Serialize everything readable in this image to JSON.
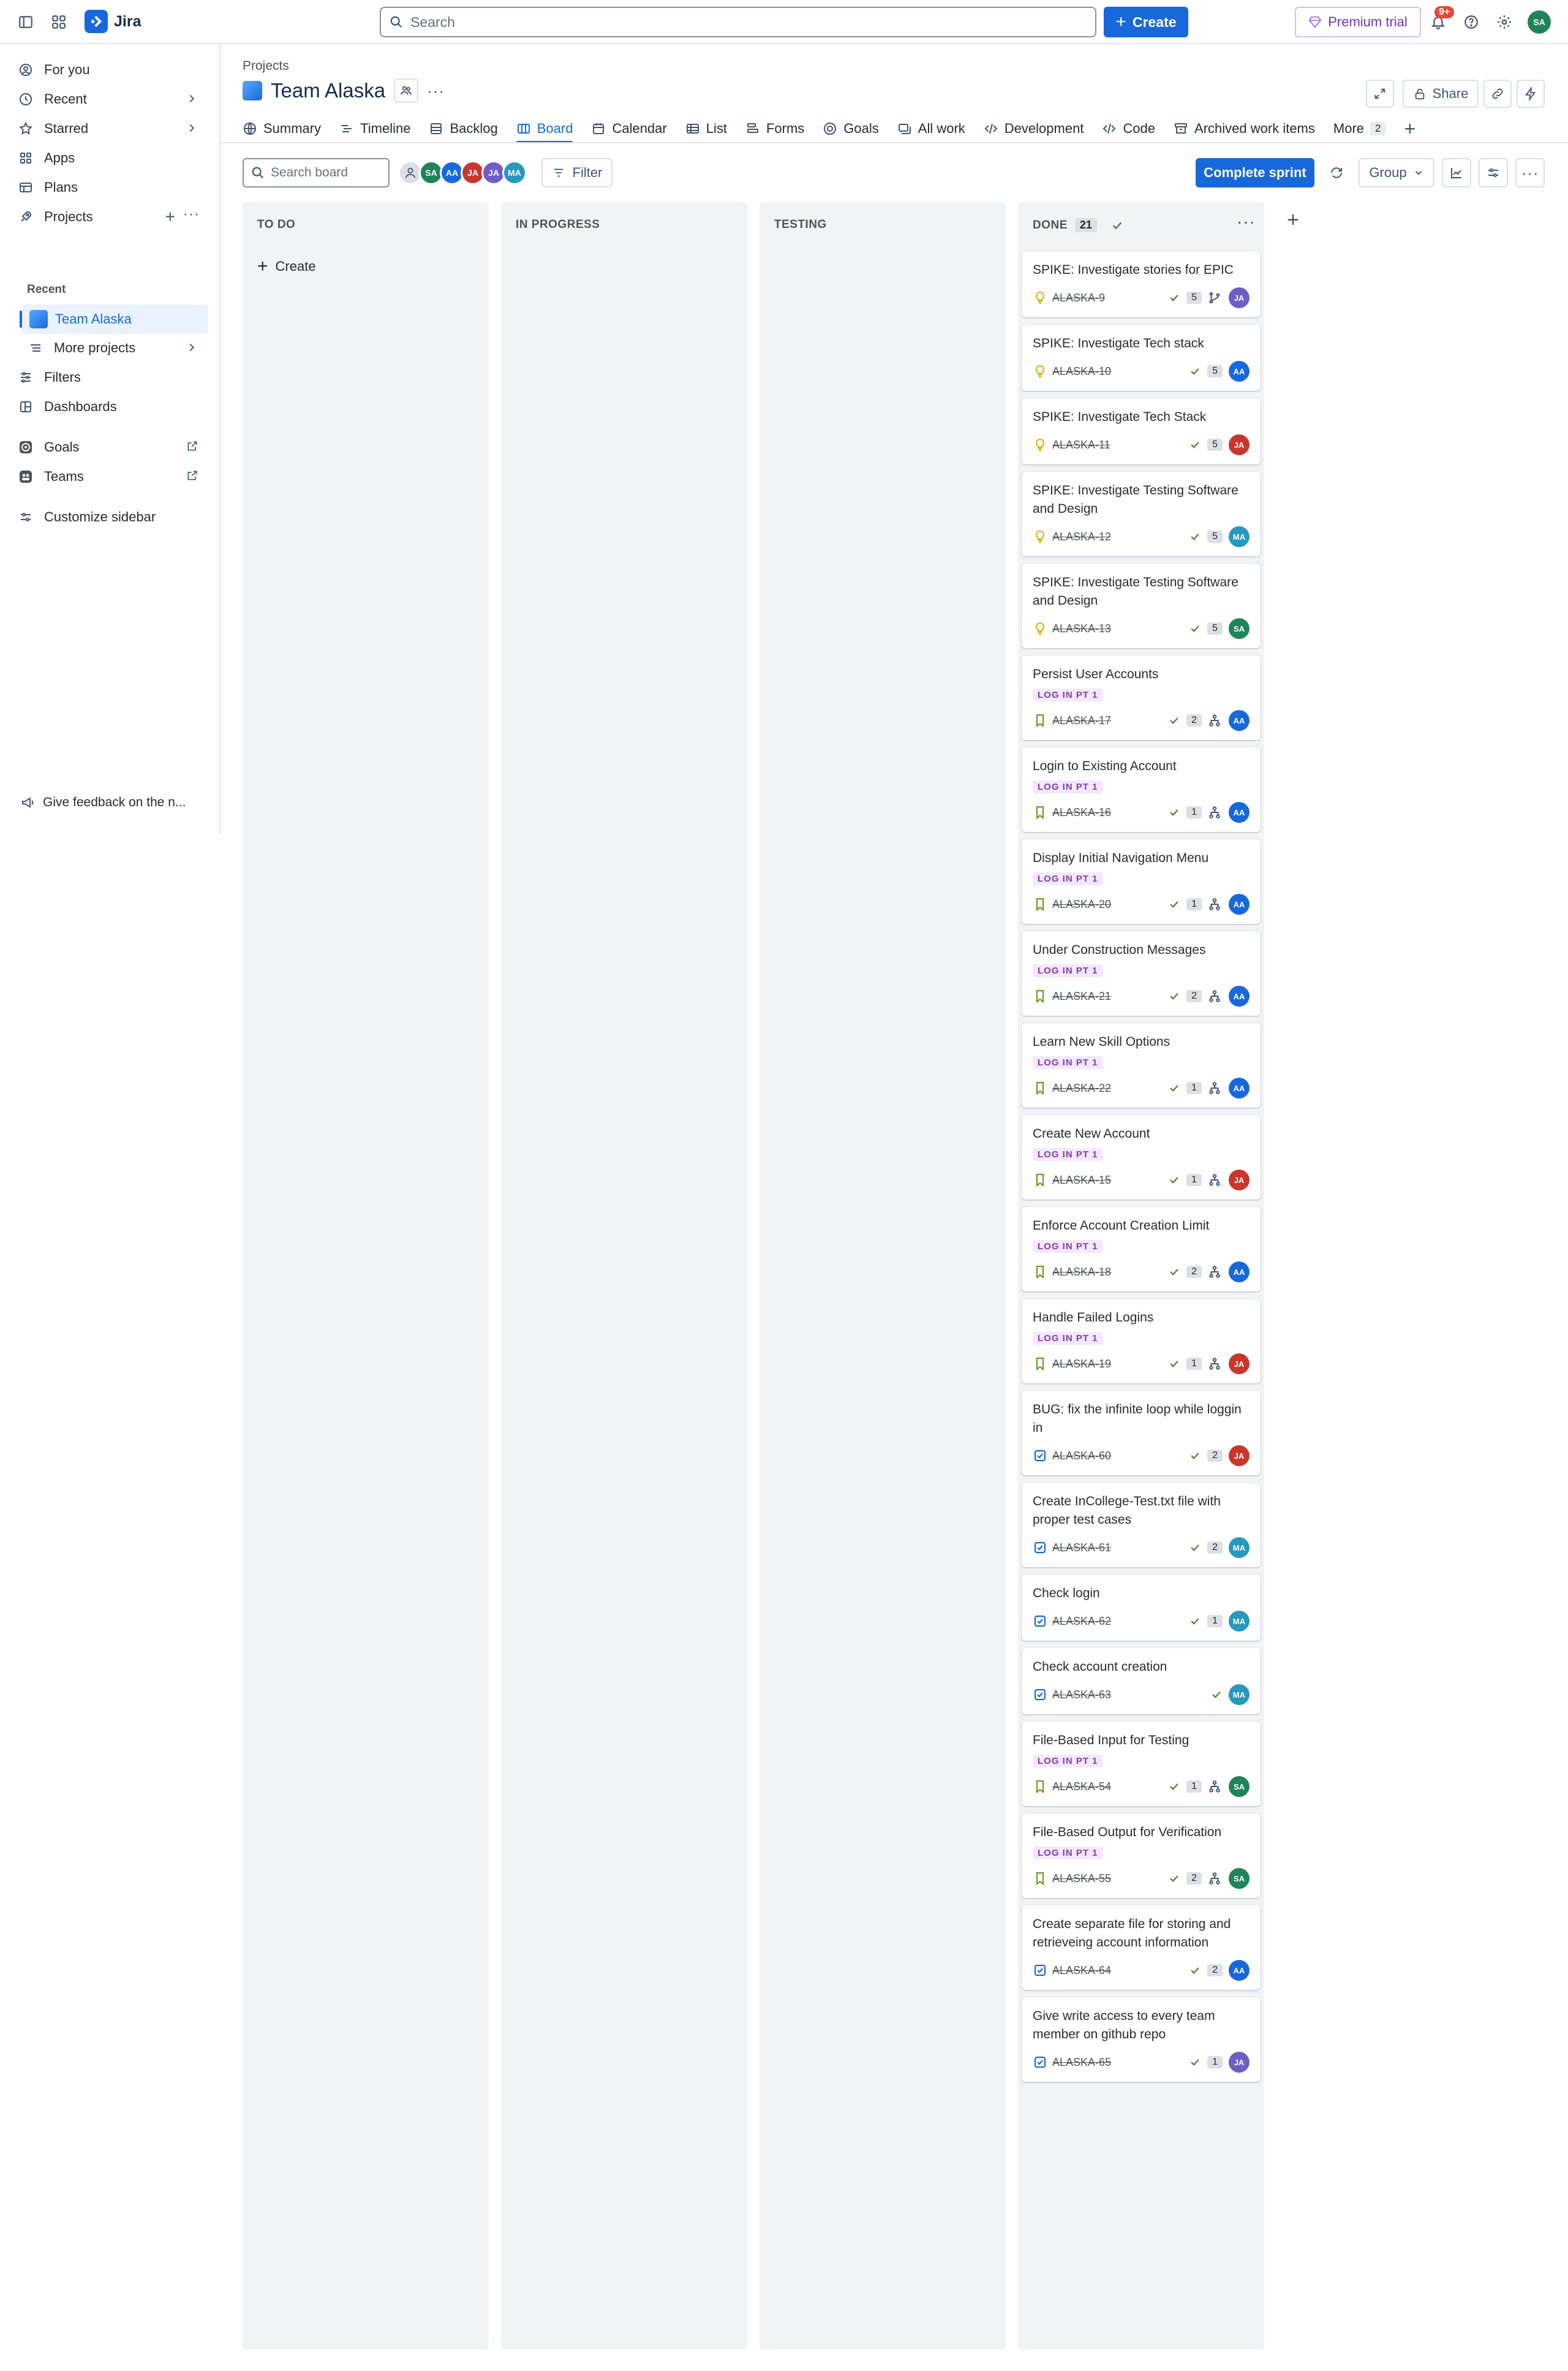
{
  "app": {
    "name": "Jira"
  },
  "topbar": {
    "search_placeholder": "Search",
    "create_label": "Create",
    "premium_label": "Premium trial",
    "notifications_badge": "9+",
    "user_initials": "SA",
    "user_color": "#1f845a"
  },
  "sidebar": {
    "items": [
      {
        "label": "For you",
        "icon": "person-circle-icon"
      },
      {
        "label": "Recent",
        "icon": "clock-icon"
      },
      {
        "label": "Starred",
        "icon": "star-icon"
      },
      {
        "label": "Apps",
        "icon": "apps-icon"
      },
      {
        "label": "Plans",
        "icon": "plans-icon"
      },
      {
        "label": "Projects",
        "icon": "rocket-icon"
      }
    ],
    "recent_label": "Recent",
    "current_project": "Team Alaska",
    "more_projects": "More projects",
    "lower_items": [
      {
        "label": "Filters",
        "icon": "filter-icon"
      },
      {
        "label": "Dashboards",
        "icon": "dashboard-icon"
      },
      {
        "label": "Goals",
        "icon": "goal-icon"
      },
      {
        "label": "Teams",
        "icon": "teams-icon"
      },
      {
        "label": "Customize sidebar",
        "icon": "customize-icon"
      }
    ],
    "feedback": "Give feedback on the n..."
  },
  "project": {
    "breadcrumb": "Projects",
    "title": "Team Alaska",
    "share_label": "Share"
  },
  "tabs": [
    {
      "label": "Summary",
      "icon": "globe-icon"
    },
    {
      "label": "Timeline",
      "icon": "timeline-icon"
    },
    {
      "label": "Backlog",
      "icon": "backlog-icon"
    },
    {
      "label": "Board",
      "icon": "board-icon",
      "active": true
    },
    {
      "label": "Calendar",
      "icon": "calendar-icon"
    },
    {
      "label": "List",
      "icon": "list-icon"
    },
    {
      "label": "Forms",
      "icon": "forms-icon"
    },
    {
      "label": "Goals",
      "icon": "goal-icon"
    },
    {
      "label": "All work",
      "icon": "all-work-icon"
    },
    {
      "label": "Development",
      "icon": "code-icon"
    },
    {
      "label": "Code",
      "icon": "code-icon"
    },
    {
      "label": "Archived work items",
      "icon": "archive-icon"
    }
  ],
  "tabs_more": {
    "label": "More",
    "count": "2"
  },
  "toolbar": {
    "search_placeholder": "Search board",
    "filter_label": "Filter",
    "complete_sprint": "Complete sprint",
    "group_label": "Group",
    "people": [
      {
        "initials": "SA",
        "color": "#1f845a"
      },
      {
        "initials": "AA",
        "color": "#1868db"
      },
      {
        "initials": "JA",
        "color": "#c9372c"
      },
      {
        "initials": "JA",
        "color": "#6e5dc6"
      },
      {
        "initials": "MA",
        "color": "#2898bd"
      }
    ]
  },
  "columns": [
    {
      "name": "TO DO",
      "create_label": "Create"
    },
    {
      "name": "IN PROGRESS"
    },
    {
      "name": "TESTING"
    },
    {
      "name": "DONE",
      "count": "21"
    }
  ],
  "cards": [
    {
      "title": "SPIKE: Investigate stories for EPIC",
      "type": "spike",
      "key": "ALASKA-9",
      "points": "5",
      "extra": "branch",
      "assignee": "JA",
      "color": "#6e5dc6"
    },
    {
      "title": "SPIKE: Investigate Tech stack",
      "type": "spike",
      "key": "ALASKA-10",
      "points": "5",
      "assignee": "AA",
      "color": "#1868db"
    },
    {
      "title": "SPIKE: Investigate Tech Stack",
      "type": "spike",
      "key": "ALASKA-11",
      "points": "5",
      "assignee": "JA",
      "color": "#c9372c"
    },
    {
      "title": "SPIKE: Investigate Testing Software and Design",
      "type": "spike",
      "key": "ALASKA-12",
      "points": "5",
      "assignee": "MA",
      "color": "#2898bd"
    },
    {
      "title": "SPIKE: Investigate Testing Software and Design",
      "type": "spike",
      "key": "ALASKA-13",
      "points": "5",
      "assignee": "SA",
      "color": "#1f845a"
    },
    {
      "title": "Persist User Accounts",
      "type": "story",
      "label": "LOG IN PT 1",
      "key": "ALASKA-17",
      "points": "2",
      "extra": "hierarchy",
      "assignee": "AA",
      "color": "#1868db"
    },
    {
      "title": "Login to Existing Account",
      "type": "story",
      "label": "LOG IN PT 1",
      "key": "ALASKA-16",
      "points": "1",
      "extra": "hierarchy",
      "assignee": "AA",
      "color": "#1868db"
    },
    {
      "title": "Display Initial Navigation Menu",
      "type": "story",
      "label": "LOG IN PT 1",
      "key": "ALASKA-20",
      "points": "1",
      "extra": "hierarchy",
      "assignee": "AA",
      "color": "#1868db"
    },
    {
      "title": "Under Construction Messages",
      "type": "story",
      "label": "LOG IN PT 1",
      "key": "ALASKA-21",
      "points": "2",
      "extra": "hierarchy",
      "assignee": "AA",
      "color": "#1868db"
    },
    {
      "title": "Learn New Skill Options",
      "type": "story",
      "label": "LOG IN PT 1",
      "key": "ALASKA-22",
      "points": "1",
      "extra": "hierarchy",
      "assignee": "AA",
      "color": "#1868db"
    },
    {
      "title": "Create New Account",
      "type": "story",
      "label": "LOG IN PT 1",
      "key": "ALASKA-15",
      "points": "1",
      "extra": "hierarchy",
      "assignee": "JA",
      "color": "#c9372c"
    },
    {
      "title": "Enforce Account Creation Limit",
      "type": "story",
      "label": "LOG IN PT 1",
      "key": "ALASKA-18",
      "points": "2",
      "extra": "hierarchy",
      "assignee": "AA",
      "color": "#1868db"
    },
    {
      "title": "Handle Failed Logins",
      "type": "story",
      "label": "LOG IN PT 1",
      "key": "ALASKA-19",
      "points": "1",
      "extra": "hierarchy",
      "assignee": "JA",
      "color": "#c9372c"
    },
    {
      "title": "BUG: fix the infinite loop while loggin in",
      "type": "task",
      "key": "ALASKA-60",
      "points": "2",
      "assignee": "JA",
      "color": "#c9372c"
    },
    {
      "title": "Create InCollege-Test.txt file with proper test cases",
      "type": "task",
      "key": "ALASKA-61",
      "points": "2",
      "assignee": "MA",
      "color": "#2898bd"
    },
    {
      "title": "Check login",
      "type": "task",
      "key": "ALASKA-62",
      "points": "1",
      "assignee": "MA",
      "color": "#2898bd"
    },
    {
      "title": "Check account creation",
      "type": "task",
      "key": "ALASKA-63",
      "assignee": "MA",
      "color": "#2898bd"
    },
    {
      "title": "File-Based Input for Testing",
      "type": "story",
      "label": "LOG IN PT 1",
      "key": "ALASKA-54",
      "points": "1",
      "extra": "hierarchy",
      "assignee": "SA",
      "color": "#1f845a"
    },
    {
      "title": "File-Based Output for Verification",
      "type": "story",
      "label": "LOG IN PT 1",
      "key": "ALASKA-55",
      "points": "2",
      "extra": "hierarchy",
      "assignee": "SA",
      "color": "#1f845a"
    },
    {
      "title": "Create separate file for storing and retrieveing account information",
      "type": "task",
      "key": "ALASKA-64",
      "points": "2",
      "assignee": "AA",
      "color": "#1868db"
    },
    {
      "title": "Give write access to every team member on github repo",
      "type": "task",
      "key": "ALASKA-65",
      "points": "1",
      "assignee": "JA",
      "color": "#6e5dc6"
    }
  ]
}
